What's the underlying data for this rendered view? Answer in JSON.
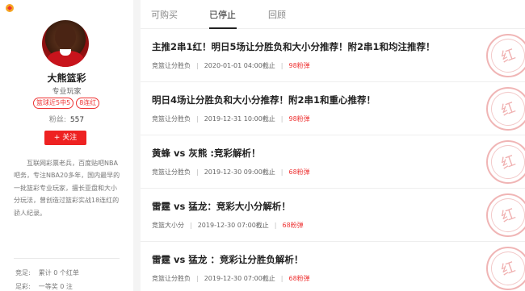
{
  "profile": {
    "name": "大熊篮彩",
    "title": "专业玩家",
    "badges": [
      "篮球近5中5",
      "8连红"
    ],
    "fans_label": "粉丝:",
    "fans_count": "557",
    "follow_label": "+ 关注",
    "bio": "互联网彩票老兵，百度贴吧NBA吧务，专注NBA20多年，国内最早的一批篮彩专业玩家，擅长亚盘和大小分玩法，曾创造过篮彩实战18连红的骄人纪录。",
    "stats": [
      {
        "label": "竞足:",
        "value": "累计 0 个红单"
      },
      {
        "label": "足彩:",
        "value": "一等奖 0 注"
      }
    ]
  },
  "tabs": [
    {
      "label": "可购买"
    },
    {
      "label": "已停止"
    },
    {
      "label": "回顾"
    }
  ],
  "stamp_text": "红",
  "articles": [
    {
      "title": "主推2串1红！明日5场让分胜负和大小分推荐！附2串1和均注推荐！",
      "category": "竞篮让分胜负",
      "time": "2020-01-01 04:00截止",
      "price": "98粉弹"
    },
    {
      "title": "明日4场让分胜负和大小分推荐！附2串1和重心推荐！",
      "category": "竞篮让分胜负",
      "time": "2019-12-31 10:00截止",
      "price": "98粉弹"
    },
    {
      "title": "黄蜂 vs 灰熊 :竞彩解析！",
      "category": "竞篮让分胜负",
      "time": "2019-12-30 09:00截止",
      "price": "68粉弹"
    },
    {
      "title": "雷霆 vs 猛龙：竞彩大小分解析！",
      "category": "竞篮大小分",
      "time": "2019-12-30 07:00截止",
      "price": "68粉弹"
    },
    {
      "title": "雷霆 vs 猛龙 ：竞彩让分胜负解析！",
      "category": "竞篮让分胜负",
      "time": "2019-12-30 07:00截止",
      "price": "68粉弹"
    }
  ]
}
